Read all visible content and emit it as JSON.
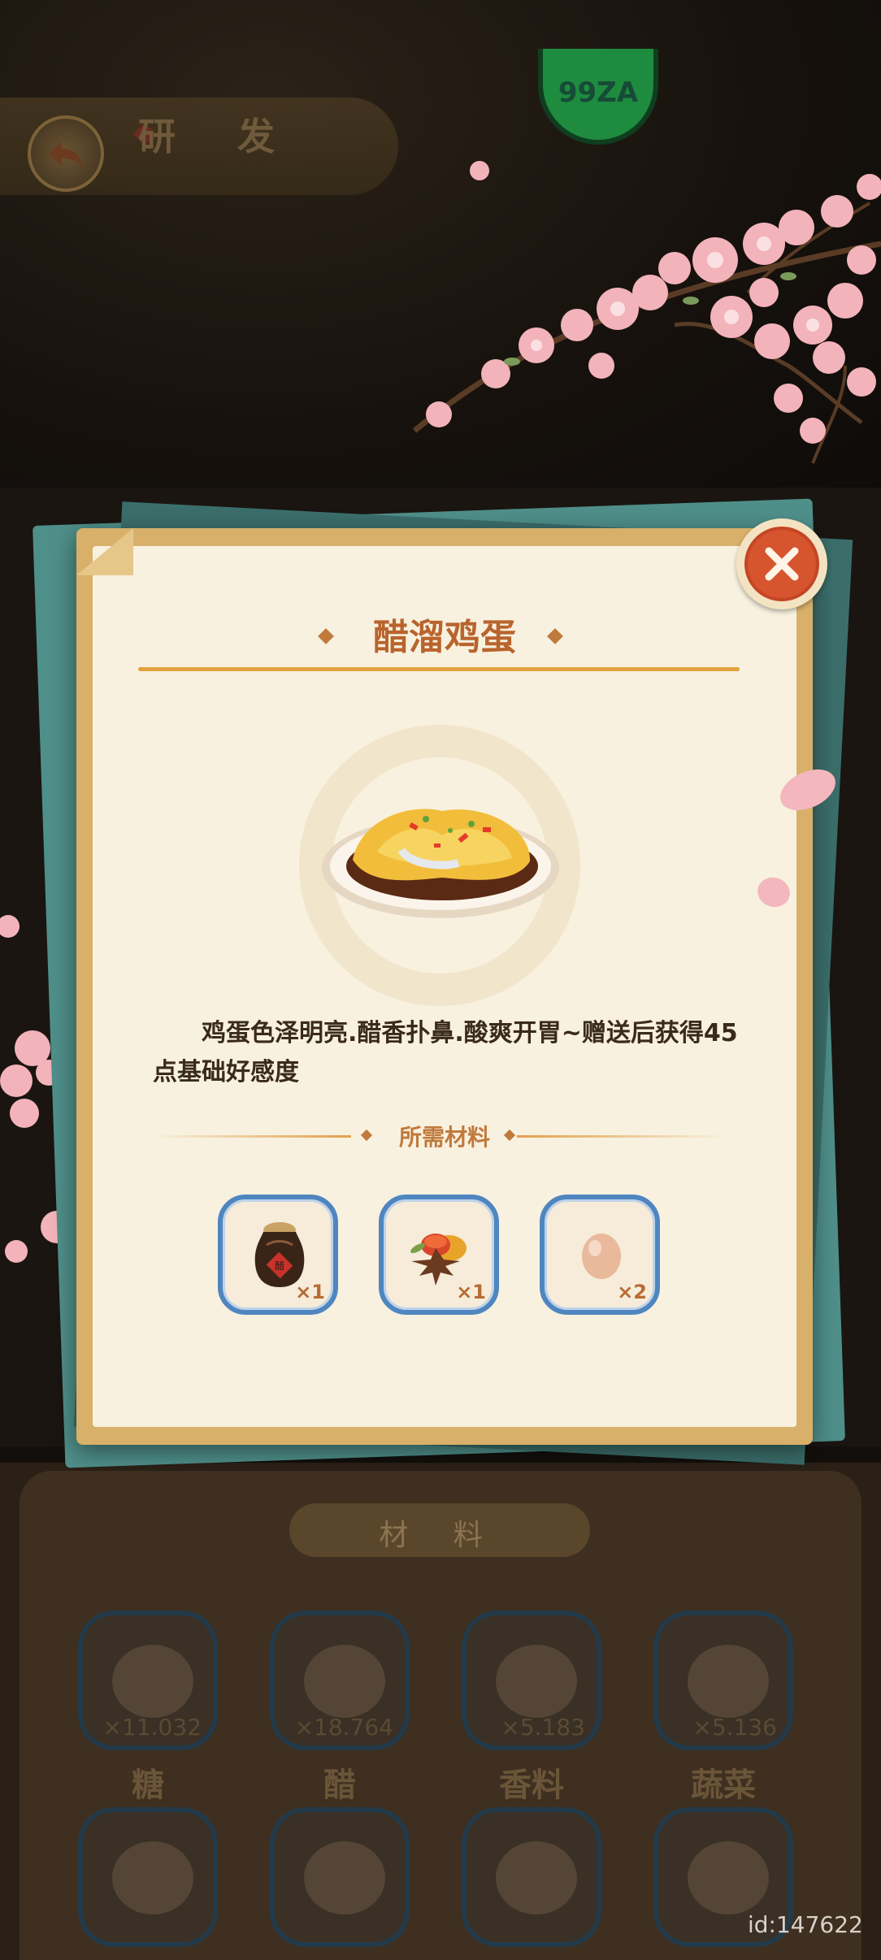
{
  "header": {
    "title": "研 发",
    "badge_text": "99ZA"
  },
  "modal": {
    "title": "醋溜鸡蛋",
    "description": "鸡蛋色泽明亮.醋香扑鼻.酸爽开胃~赠送后获得45点基础好感度",
    "required_title": "所需材料",
    "ingredients": [
      {
        "icon": "vinegar-jar-icon",
        "count": "×1"
      },
      {
        "icon": "spices-icon",
        "count": "×1"
      },
      {
        "icon": "egg-icon",
        "count": "×2"
      }
    ]
  },
  "materials": {
    "header": "材 料",
    "items": [
      {
        "name": "糖",
        "count": "×11.032"
      },
      {
        "name": "醋",
        "count": "×18.764"
      },
      {
        "name": "香料",
        "count": "×5.183"
      },
      {
        "name": "蔬菜",
        "count": "×5.136"
      }
    ]
  },
  "footer": {
    "id_text": "id:147622"
  },
  "colors": {
    "accent": "#b9642d",
    "close": "#d6542e",
    "frame": "#d8b06a",
    "paper": "#f8f1df",
    "ingredient_border": "#4f86c0"
  }
}
